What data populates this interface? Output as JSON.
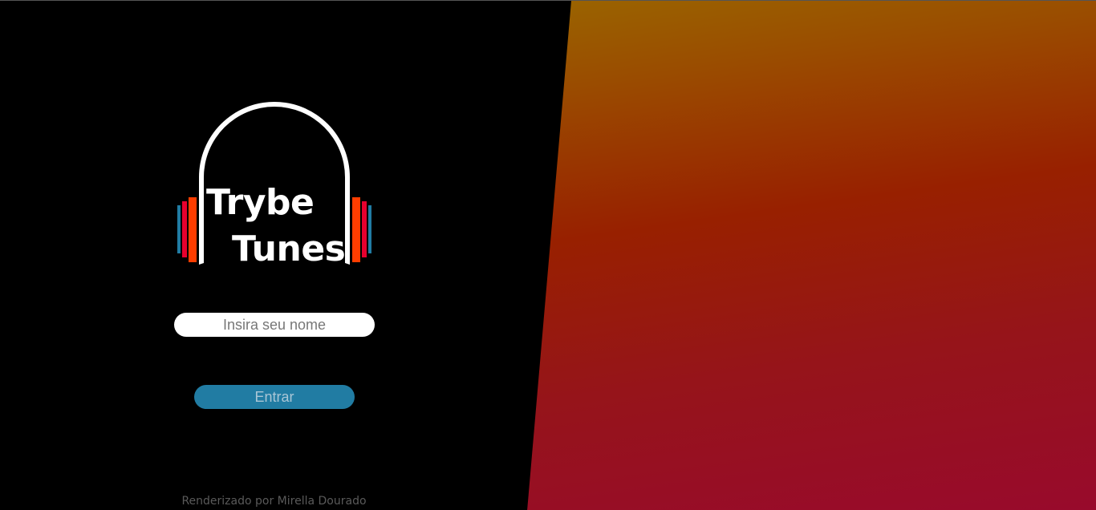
{
  "logo": {
    "line1": "Trybe",
    "line2": "Tunes",
    "colors": {
      "band": "#ffffff",
      "bar_orange": "#ff3d00",
      "bar_red": "#e8002e",
      "bar_blue": "#217ca3"
    }
  },
  "login": {
    "name_placeholder": "Insira seu nome",
    "name_value": "",
    "enter_label": "Entrar"
  },
  "footer": {
    "credit": "Renderizado por Mirella Dourado"
  },
  "theme": {
    "background": "#000000",
    "gradient_top": "#9a7800",
    "gradient_middle": "#982000",
    "gradient_bottom": "#980a2c",
    "button_color": "#217ca3"
  }
}
